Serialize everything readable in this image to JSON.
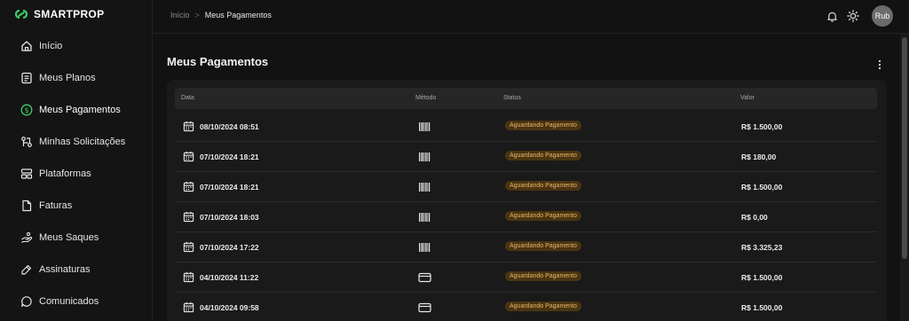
{
  "app": {
    "logo_text": "SMARTPROP",
    "accent": "#3ecf6a"
  },
  "sidebar": {
    "items": [
      {
        "label": "Início",
        "icon": "home-icon"
      },
      {
        "label": "Meus Planos",
        "icon": "plans-icon"
      },
      {
        "label": "Meus Pagamentos",
        "icon": "dollar-circle-icon",
        "active": true
      },
      {
        "label": "Minhas Solicitações",
        "icon": "requests-icon"
      },
      {
        "label": "Plataformas",
        "icon": "platforms-icon"
      },
      {
        "label": "Faturas",
        "icon": "invoice-icon"
      },
      {
        "label": "Meus Saques",
        "icon": "withdraw-icon"
      },
      {
        "label": "Assinaturas",
        "icon": "signature-icon"
      },
      {
        "label": "Comunicados",
        "icon": "chat-icon"
      }
    ]
  },
  "header": {
    "breadcrumb": {
      "home": "Início",
      "separator": ">",
      "current": "Meus Pagamentos"
    },
    "icons": [
      "bell-icon",
      "sun-icon"
    ],
    "avatar_text": "Rub"
  },
  "main": {
    "title": "Meus Pagamentos",
    "table": {
      "headers": {
        "date": "Data",
        "method": "Método",
        "status": "Status",
        "value": "Valor"
      },
      "rows": [
        {
          "date": "08/10/2024 08:51",
          "method": "barcode-icon",
          "status": "Aguardando Pagamento",
          "value": "R$ 1.500,00"
        },
        {
          "date": "07/10/2024 18:21",
          "method": "barcode-icon",
          "status": "Aguardando Pagamento",
          "value": "R$ 180,00"
        },
        {
          "date": "07/10/2024 18:21",
          "method": "barcode-icon",
          "status": "Aguardando Pagamento",
          "value": "R$ 1.500,00"
        },
        {
          "date": "07/10/2024 18:03",
          "method": "barcode-icon",
          "status": "Aguardando Pagamento",
          "value": "R$ 0,00"
        },
        {
          "date": "07/10/2024 17:22",
          "method": "barcode-icon",
          "status": "Aguardando Pagamento",
          "value": "R$ 3.325,23"
        },
        {
          "date": "04/10/2024 11:22",
          "method": "card-icon",
          "status": "Aguardando Pagamento",
          "value": "R$ 1.500,00"
        },
        {
          "date": "04/10/2024 09:58",
          "method": "card-icon",
          "status": "Aguardando Pagamento",
          "value": "R$ 1.500,00"
        }
      ]
    }
  }
}
